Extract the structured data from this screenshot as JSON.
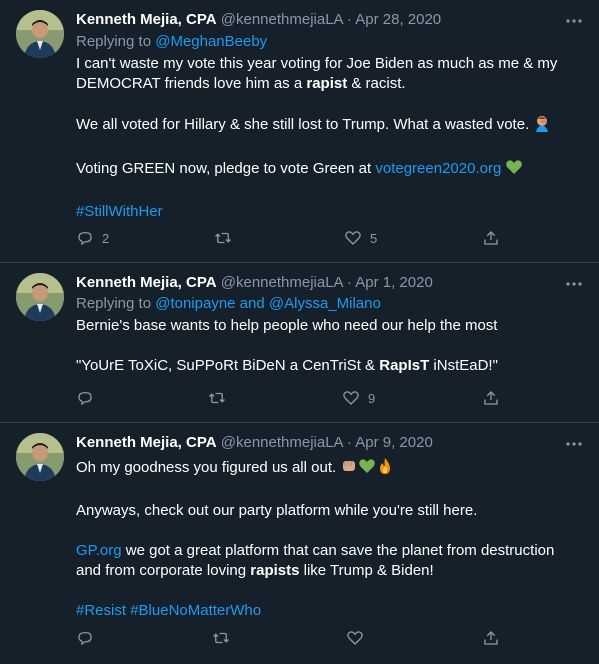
{
  "tweets": [
    {
      "name": "Kenneth Mejia, CPA",
      "handle": "@kennethmejiaLA",
      "sep": "·",
      "date": "Apr 28, 2020",
      "replying_prefix": "Replying to ",
      "replying_to": "@MeghanBeeby",
      "p1a": "I can't waste my vote this year voting for Joe Biden as much as me & my DEMOCRAT friends love him as a ",
      "p1b": "rapist",
      "p1c": " & racist.",
      "p2": "We all voted for Hillary & she still lost to Trump. What a wasted vote.",
      "p3a": "Voting GREEN now, pledge to vote Green at ",
      "p3link": "votegreen2020.org",
      "p4": "#StillWithHer",
      "reply_count": "2",
      "like_count": "5"
    },
    {
      "name": "Kenneth Mejia, CPA",
      "handle": "@kennethmejiaLA",
      "sep": "·",
      "date": "Apr 1, 2020",
      "replying_prefix": "Replying to ",
      "replying_to_1": "@tonipayne",
      "replying_and": " and ",
      "replying_to_2": "@Alyssa_Milano",
      "p1": "Bernie's base wants to help people who need our help the most",
      "p2a": "\"YoUrE ToXiC, SuPPoRt BiDeN a CenTriSt & ",
      "p2b": "RapIsT",
      "p2c": " iNstEaD!\"",
      "like_count": "9"
    },
    {
      "name": "Kenneth Mejia, CPA",
      "handle": "@kennethmejiaLA",
      "sep": "·",
      "date": "Apr 9, 2020",
      "p1": "Oh my goodness you figured us all out.",
      "p2": "Anyways, check out our party platform while you're still here.",
      "p3link": "GP.org",
      "p3a": " we got a great platform that can save the planet from destruction and from corporate loving ",
      "p3b": "rapists",
      "p3c": " like Trump & Biden!",
      "p4a": "#Resist",
      "p4b": "#BlueNoMatterWho"
    }
  ],
  "colors": {
    "background": "#15202b",
    "muted": "#8899a6",
    "link": "#1d9bf0",
    "divider": "#38444d"
  },
  "icons": [
    "reply-icon",
    "retweet-icon",
    "like-icon",
    "share-icon",
    "more-icon",
    "green-heart-emoji",
    "facepalm-emoji",
    "fist-emoji",
    "fire-emoji"
  ]
}
